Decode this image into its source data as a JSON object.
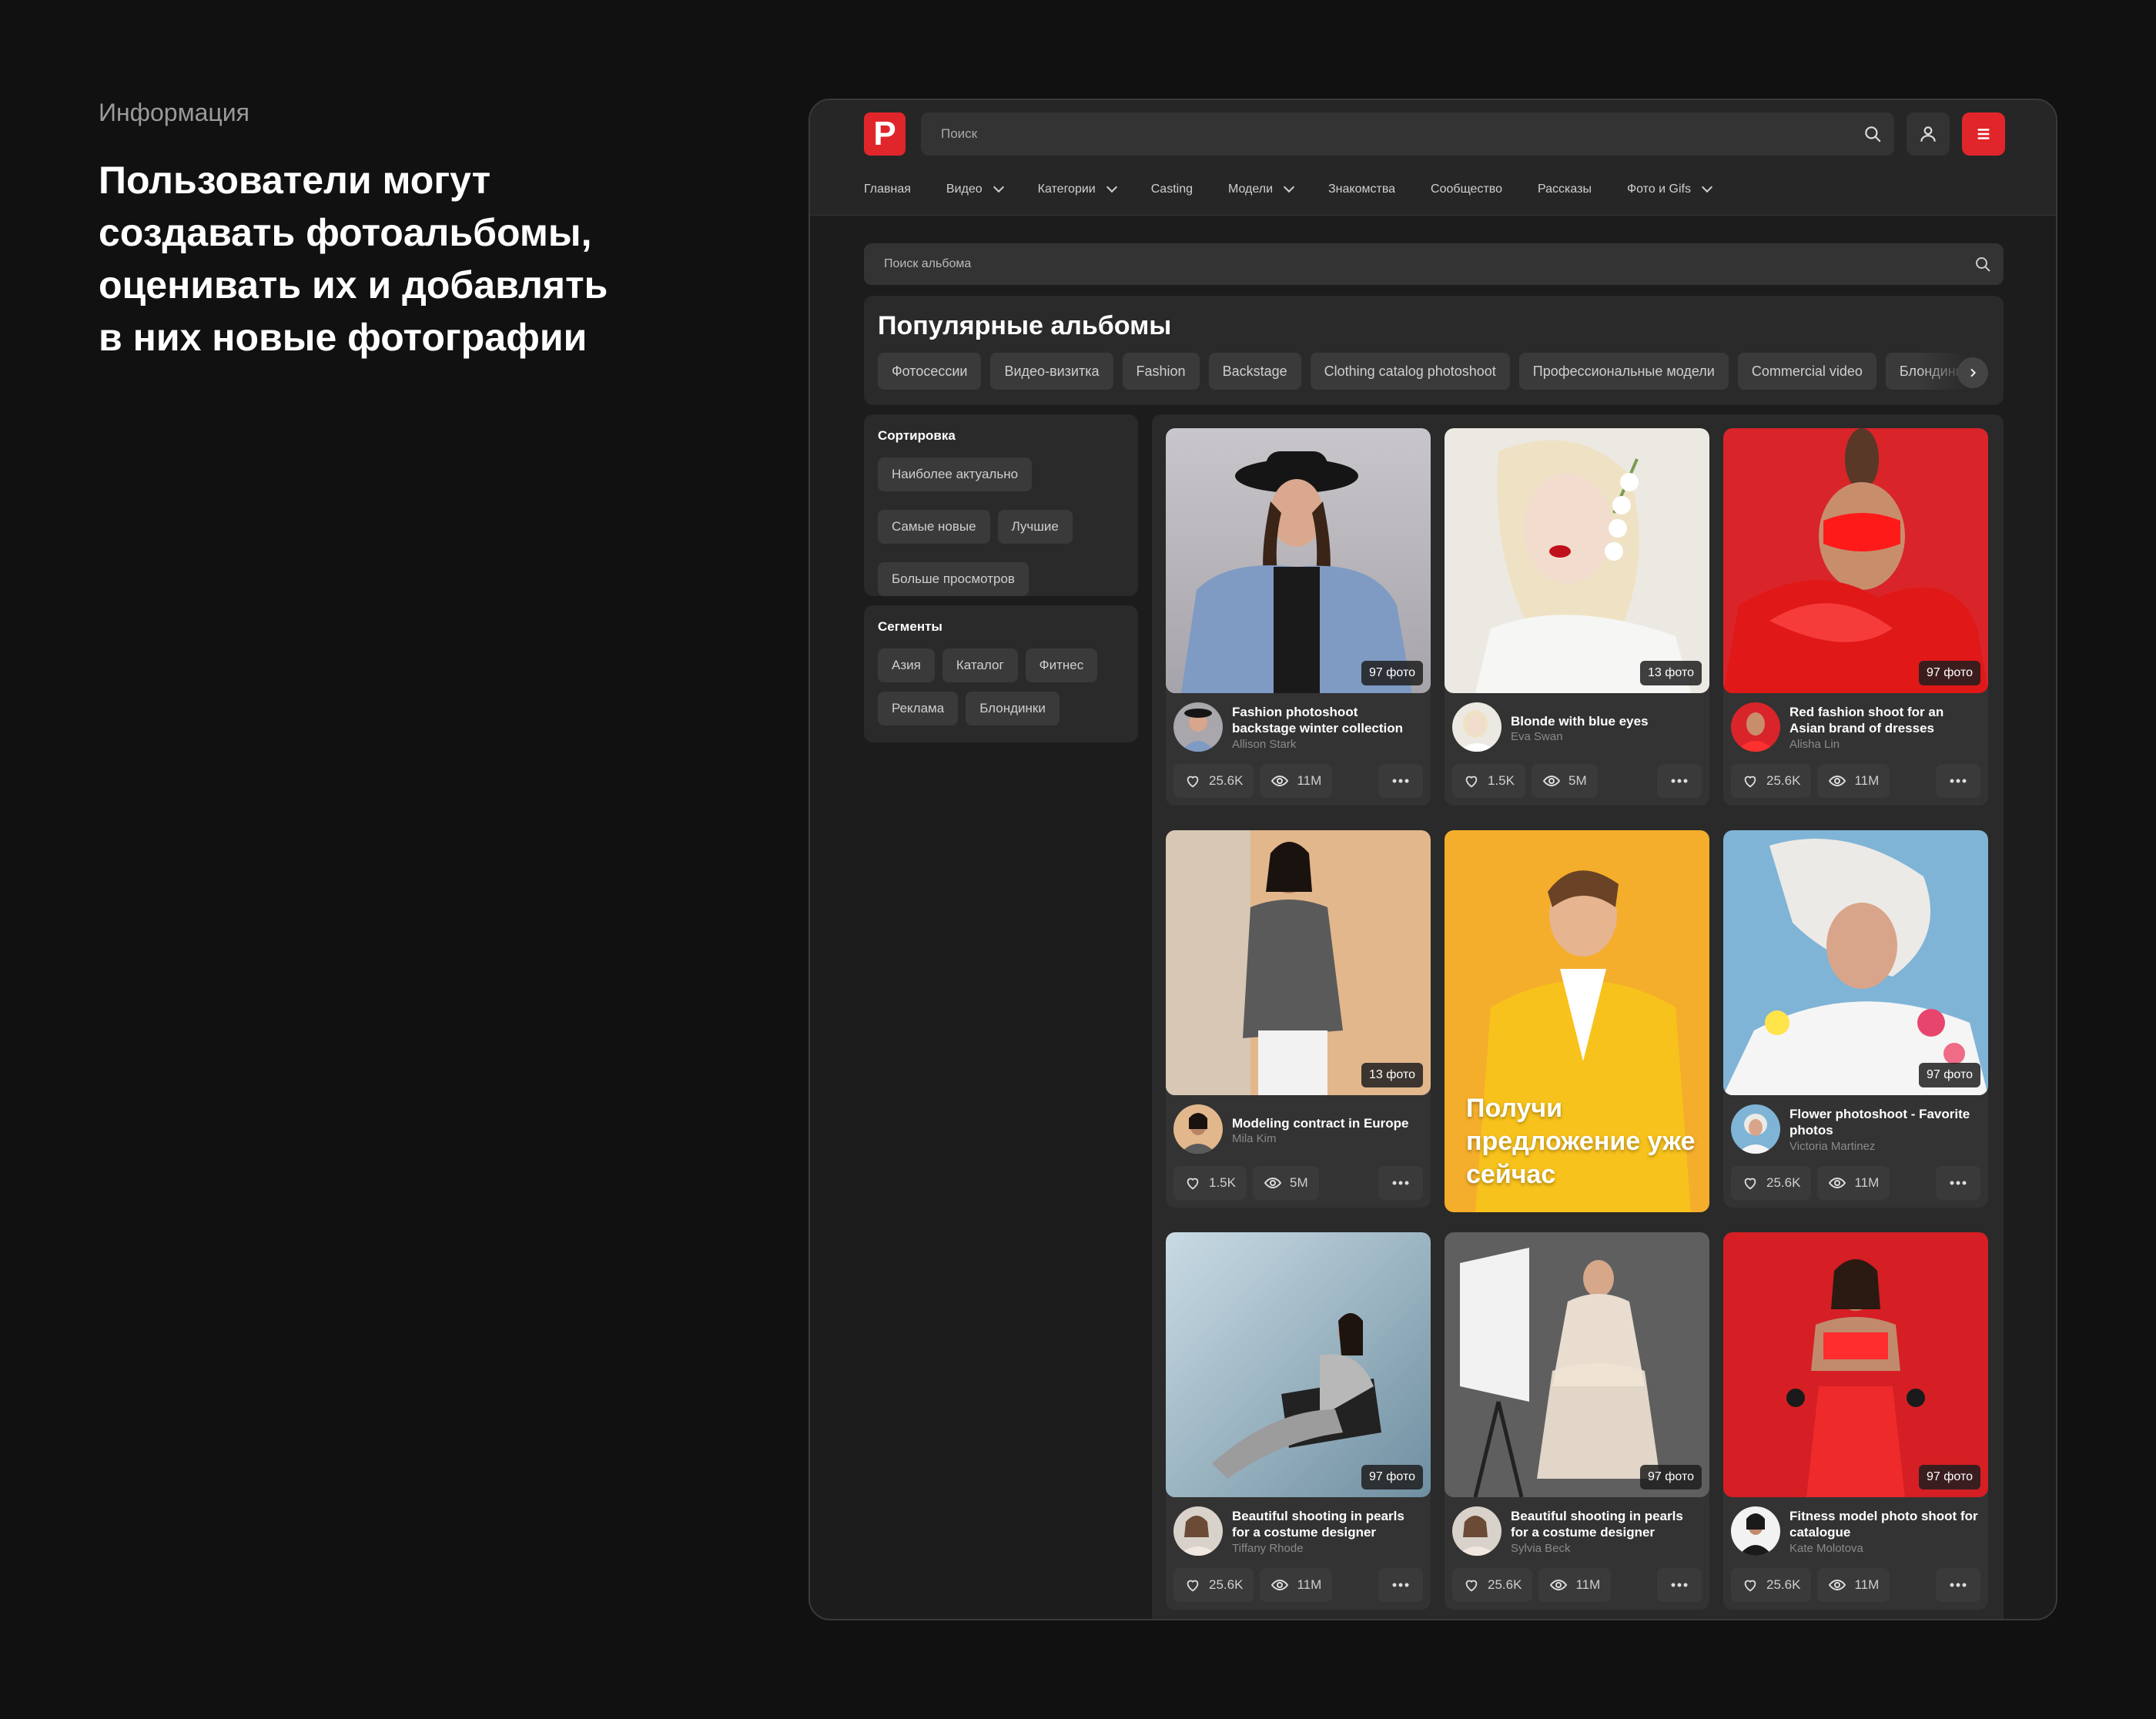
{
  "intro": {
    "label": "Информация",
    "text": "Пользователи могут создавать фотоальбомы, оценивать их и добавлять в них новые фотографии"
  },
  "header": {
    "logo_letter": "P",
    "search_placeholder": "Поиск",
    "nav": [
      "Главная",
      "Видео",
      "Категории",
      "Casting",
      "Модели",
      "Знакомства",
      "Сообщество",
      "Рассказы",
      "Фото и Gifs"
    ]
  },
  "album_search": {
    "placeholder": "Поиск альбома"
  },
  "popular": {
    "title": "Популярные альбомы",
    "chips": [
      "Фотосессии",
      "Видео-визитка",
      "Fashion",
      "Backstage",
      "Clothing catalog photoshoot",
      "Профессиональные модели",
      "Commercial video",
      "Блондинки"
    ]
  },
  "sort": {
    "title": "Сортировка",
    "options": [
      "Наиболее актуально",
      "Самые новые",
      "Лучшие",
      "Больше просмотров"
    ]
  },
  "segments": {
    "title": "Сегменты",
    "options": [
      "Азия",
      "Каталог",
      "Фитнес",
      "Реклама",
      "Блондинки"
    ]
  },
  "promo": {
    "text": "Получи предложение уже сейчас"
  },
  "albums": [
    {
      "title": "Fashion photoshoot backstage winter collection",
      "author": "Allison Stark",
      "photos": "97 фото",
      "likes": "25.6K",
      "views": "11M"
    },
    {
      "title": "Blonde with blue eyes",
      "author": "Eva Swan",
      "photos": "13 фото",
      "likes": "1.5K",
      "views": "5M"
    },
    {
      "title": "Red fashion shoot for an Asian brand of dresses",
      "author": "Alisha Lin",
      "photos": "97 фото",
      "likes": "25.6K",
      "views": "11M"
    },
    {
      "title": "Modeling contract in Europe",
      "author": "Mila Kim",
      "photos": "13 фото",
      "likes": "1.5K",
      "views": "5M"
    },
    {
      "title": "Flower photoshoot - Favorite photos",
      "author": "Victoria Martinez",
      "photos": "97 фото",
      "likes": "25.6K",
      "views": "11M"
    },
    {
      "title": "Beautiful shooting in pearls for a costume designer",
      "author": "Tiffany Rhode",
      "photos": "97 фото",
      "likes": "25.6K",
      "views": "11M"
    },
    {
      "title": "Beautiful shooting in pearls for a costume designer",
      "author": "Sylvia Beck",
      "photos": "97 фото",
      "likes": "25.6K",
      "views": "11M"
    },
    {
      "title": "Fitness model photo shoot for catalogue",
      "author": "Kate Molotova",
      "photos": "97 фото",
      "likes": "25.6K",
      "views": "11M"
    }
  ],
  "colors": {
    "accent": "#e0262b",
    "background": "#111111",
    "panel": "#2a2a2a"
  },
  "icons": [
    "search-icon",
    "user-icon",
    "menu-icon",
    "chevron-right-icon",
    "heart-icon",
    "eye-icon",
    "more-icon"
  ]
}
